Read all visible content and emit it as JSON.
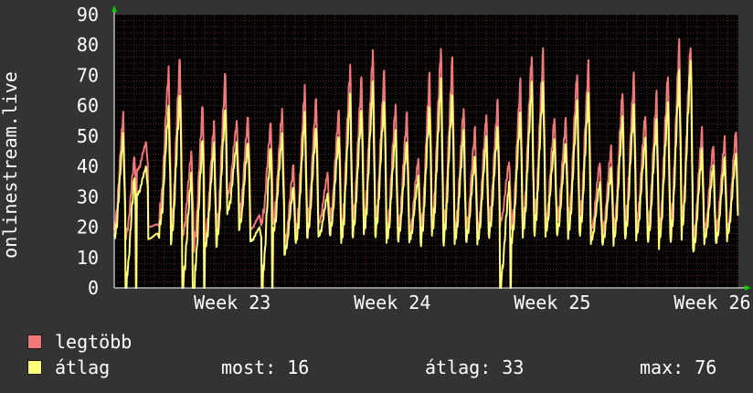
{
  "chart_data": {
    "type": "line",
    "ylabel": "onlinestream.live",
    "ylim": [
      0,
      90
    ],
    "yticks": [
      0,
      10,
      20,
      30,
      40,
      50,
      60,
      70,
      80,
      90
    ],
    "x_tick_labels": [
      "Week 23",
      "Week 24",
      "Week 25",
      "Week 26"
    ],
    "grid": true,
    "colors": {
      "background": "#333333",
      "plot_area": "#000000",
      "grid": "#5a2a2a",
      "axis_arrow": "#00cc00",
      "legtobb": "#f07878",
      "atlag": "#ffff78"
    },
    "series": [
      {
        "name": "legtöbb",
        "color": "#f07878",
        "daily_peaks": [
          58,
          44,
          48,
          21,
          73,
          77,
          45,
          61,
          55,
          72,
          55,
          57,
          24,
          55,
          59,
          41,
          67,
          63,
          38,
          59,
          74,
          70,
          79,
          72,
          61,
          58,
          43,
          71,
          80,
          76,
          60,
          53,
          58,
          62,
          42,
          69,
          78,
          79,
          57,
          56,
          72,
          75,
          42,
          47,
          66,
          71,
          58,
          65,
          72,
          82,
          82,
          53,
          48,
          50,
          53
        ],
        "daily_troughs": [
          17,
          15,
          38,
          20,
          22,
          16,
          15,
          10,
          14,
          15,
          29,
          22,
          19,
          20,
          20,
          13,
          15,
          19,
          20,
          20,
          15,
          19,
          19,
          18,
          16,
          17,
          17,
          15,
          18,
          15,
          16,
          17,
          16,
          19,
          20,
          16,
          18,
          18,
          19,
          20,
          19,
          18,
          17,
          16,
          16,
          17,
          19,
          16,
          15,
          15,
          18,
          13,
          17,
          16,
          16
        ]
      },
      {
        "name": "átlag",
        "color": "#ffff78",
        "daily_peaks": [
          51,
          38,
          40,
          18,
          60,
          66,
          38,
          51,
          48,
          61,
          48,
          49,
          20,
          48,
          51,
          34,
          58,
          54,
          31,
          51,
          64,
          60,
          68,
          63,
          52,
          49,
          37,
          61,
          69,
          65,
          52,
          44,
          50,
          54,
          35,
          59,
          68,
          69,
          49,
          48,
          62,
          65,
          35,
          40,
          57,
          61,
          50,
          56,
          62,
          72,
          76,
          46,
          41,
          43,
          45
        ],
        "daily_troughs": [
          14,
          0,
          30,
          16,
          18,
          13,
          0,
          0,
          11,
          12,
          24,
          18,
          15,
          0,
          16,
          10,
          12,
          15,
          16,
          16,
          12,
          15,
          15,
          15,
          13,
          14,
          14,
          12,
          15,
          12,
          13,
          14,
          13,
          15,
          0,
          13,
          15,
          15,
          16,
          16,
          15,
          15,
          14,
          13,
          13,
          14,
          15,
          13,
          12,
          12,
          15,
          10,
          14,
          13,
          15
        ]
      }
    ]
  },
  "legend": {
    "items": [
      {
        "label": "legtöbb",
        "color": "#f07878"
      },
      {
        "label": "átlag",
        "color": "#ffff78"
      }
    ]
  },
  "stats": {
    "now": "most: 16",
    "avg": "átlag: 33",
    "max": "max: 76"
  }
}
